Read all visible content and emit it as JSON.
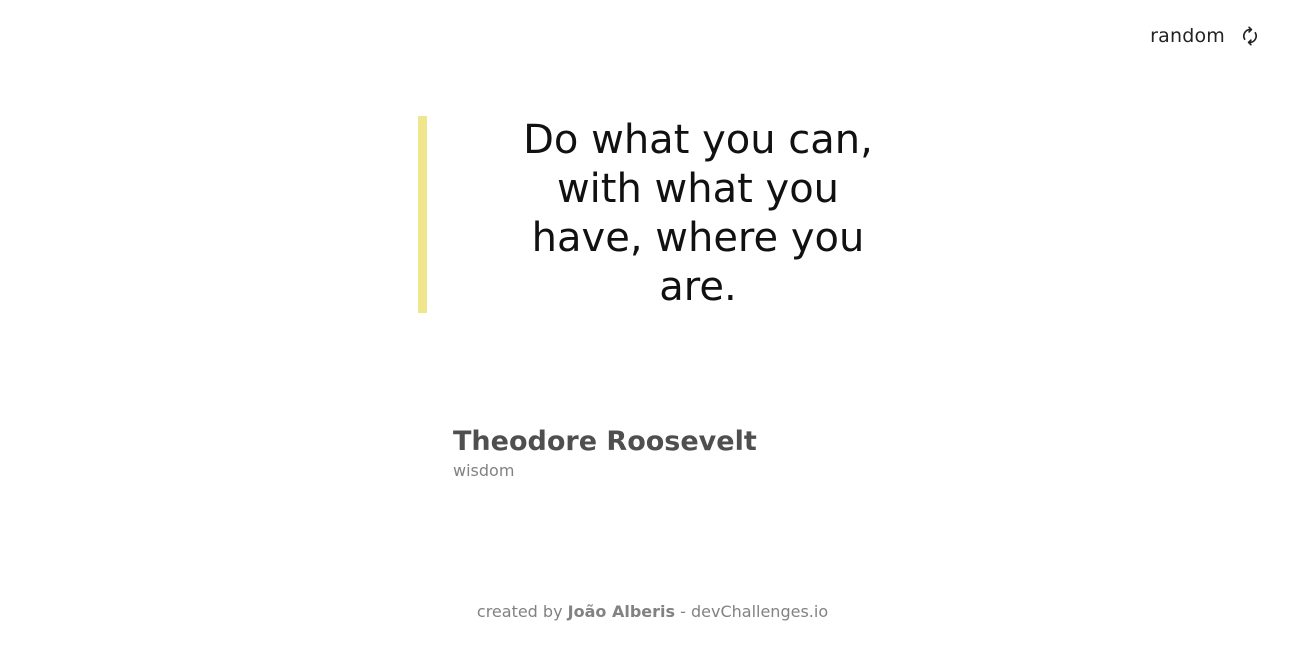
{
  "header": {
    "random_label": "random",
    "random_icon": "refresh-icon"
  },
  "quote": {
    "text": "Do what you can, with what you have, where you are.",
    "accent_color": "#f0e68c"
  },
  "author": {
    "name": "Theodore Roosevelt",
    "genre": "wisdom"
  },
  "footer": {
    "prefix": "created by",
    "author": "João Alberis",
    "separator": "-",
    "site": "devChallenges.io"
  }
}
